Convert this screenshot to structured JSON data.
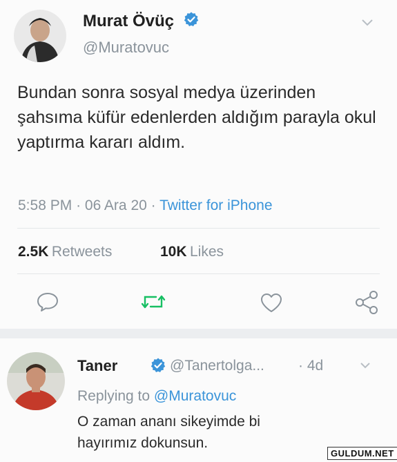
{
  "tweet": {
    "author_name": "Murat Övüç",
    "author_handle": "@Muratovuc",
    "text": "Bundan sonra sosyal medya üzerinden şahsıma küfür edenlerden aldığım parayla okul yaptırma kararı aldım.",
    "time": "5:58 PM",
    "date": "06 Ara 20",
    "source": "Twitter for iPhone",
    "retweets_count": "2.5K",
    "retweets_label": "Retweets",
    "likes_count": "10K",
    "likes_label": "Likes"
  },
  "reply": {
    "author_name": "Taner",
    "author_handle": "@Tanertolga...",
    "age": "4d",
    "replying_prefix": "Replying to",
    "replying_to": "@Muratovuc",
    "text_line1": "O zaman ananı sikeyimde bi",
    "text_line2": "hayırımız dokunsun."
  },
  "watermark": "GULDUM.NET",
  "colors": {
    "link": "#3b94d9",
    "retweet": "#17bf63",
    "muted": "#8a939b"
  },
  "icons": [
    "verified-badge-icon",
    "chevron-down-icon",
    "reply-icon",
    "retweet-icon",
    "like-icon",
    "share-icon"
  ]
}
